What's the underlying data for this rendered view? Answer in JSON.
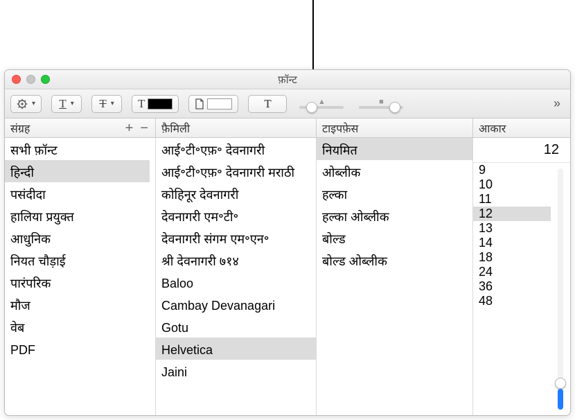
{
  "window_title": "फ़ॉन्ट",
  "toolbar": {
    "underline_glyph": "T",
    "strike_glyph": "T",
    "textcolor_glyph": "T",
    "doc_glyph": "▯",
    "effects_glyph": "T"
  },
  "headers": {
    "collection": "संग्रह",
    "family": "फ़ैमिली",
    "typeface": "टाइपफ़ेस",
    "size": "आकार"
  },
  "collection_selected": "हिन्दी",
  "collections": [
    "सभी फ़ॉन्ट",
    "हिन्दी",
    "पसंदीदा",
    "हालिया प्रयुक्त",
    "आधुनिक",
    "नियत चौड़ाई",
    "पारंपरिक",
    "मौज",
    "वेब",
    "PDF"
  ],
  "family_selected": "Helvetica",
  "families": [
    "आई॰टी॰एफ़॰ देवनागरी",
    "आई॰टी॰एफ़॰ देवनागरी मराठी",
    "कोहिनूर देवनागरी",
    "देवनागरी एम॰टी॰",
    "देवनागरी संगम एम॰एन॰",
    "श्री देवनागरी ७१४",
    "Baloo",
    "Cambay Devanagari",
    "Gotu",
    "Helvetica",
    "Jaini"
  ],
  "typeface_selected": "नियमित",
  "typefaces": [
    "नियमित",
    "ओब्लीक",
    "हल्का",
    "हल्का ओब्लीक",
    "बोल्ड",
    "बोल्ड ओब्लीक"
  ],
  "size_value": "12",
  "size_selected": "12",
  "sizes": [
    "9",
    "10",
    "11",
    "12",
    "13",
    "14",
    "18",
    "24",
    "36",
    "48"
  ]
}
